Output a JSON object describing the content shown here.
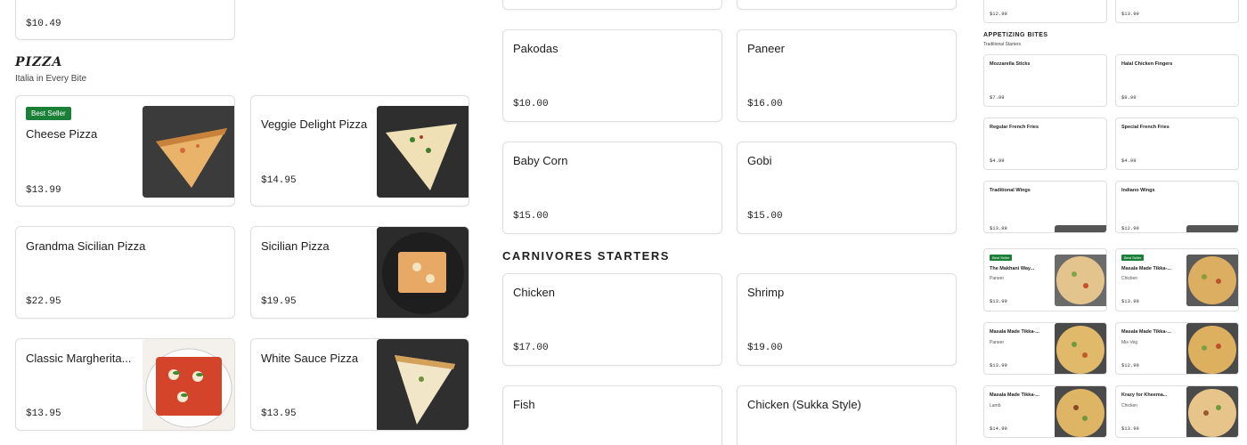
{
  "top": {
    "left_price": "$10.49",
    "right_price_a": "$12.99",
    "right_price_b": "$13.99"
  },
  "pizza": {
    "title": "pizza",
    "subtitle": "Italia in Every Bite",
    "items": [
      {
        "name": "Cheese Pizza",
        "price": "$13.99",
        "badge": "Best Seller"
      },
      {
        "name": "Veggie Delight Pizza",
        "price": "$14.95"
      },
      {
        "name": "Grandma Sicilian Pizza",
        "price": "$22.95"
      },
      {
        "name": "Sicilian Pizza",
        "price": "$19.95"
      },
      {
        "name": "Classic Margherita...",
        "price": "$13.95"
      },
      {
        "name": "White Sauce Pizza",
        "price": "$13.95"
      }
    ]
  },
  "veg": {
    "items": [
      {
        "name": "Pakodas",
        "price": "$10.00"
      },
      {
        "name": "Paneer",
        "price": "$16.00"
      },
      {
        "name": "Baby Corn",
        "price": "$15.00"
      },
      {
        "name": "Gobi",
        "price": "$15.00"
      }
    ]
  },
  "carnivores": {
    "title": "Carnivores Starters",
    "items": [
      {
        "name": "Chicken",
        "price": "$17.00"
      },
      {
        "name": "Shrimp",
        "price": "$19.00"
      },
      {
        "name": "Fish"
      },
      {
        "name": "Chicken (Sukka Style)"
      }
    ]
  },
  "appetizing": {
    "title": "APPETIZING BITES",
    "subtitle": "Traditional Starters",
    "items": [
      {
        "name": "Mozzarella Sticks",
        "price": "$7.99"
      },
      {
        "name": "Halal Chicken Fingers",
        "price": "$9.99"
      },
      {
        "name": "Regular French Fries",
        "price": "$4.99"
      },
      {
        "name": "Special French Fries",
        "price": "$4.99"
      },
      {
        "name": "Traditional Wings",
        "price": "$13.99"
      },
      {
        "name": "Indiano Wings",
        "price": "$12.99"
      }
    ]
  },
  "specialty": {
    "badge": "Best Seller",
    "items": [
      {
        "name": "The Makhani Way...",
        "sub": "Paneer",
        "price": "$13.99"
      },
      {
        "name": "Masala Made Tikka-...",
        "sub": "Chicken",
        "price": "$13.99"
      },
      {
        "name": "Masala Made Tikka-...",
        "sub": "Paneer",
        "price": "$13.99"
      },
      {
        "name": "Masala Made Tikka-...",
        "sub": "Mix-Veg",
        "price": "$12.99"
      },
      {
        "name": "Masala Made Tikka-...",
        "sub": "Lamb",
        "price": "$14.99"
      },
      {
        "name": "Krazy for Kheema...",
        "sub": "Chicken",
        "price": "$13.99"
      }
    ]
  }
}
